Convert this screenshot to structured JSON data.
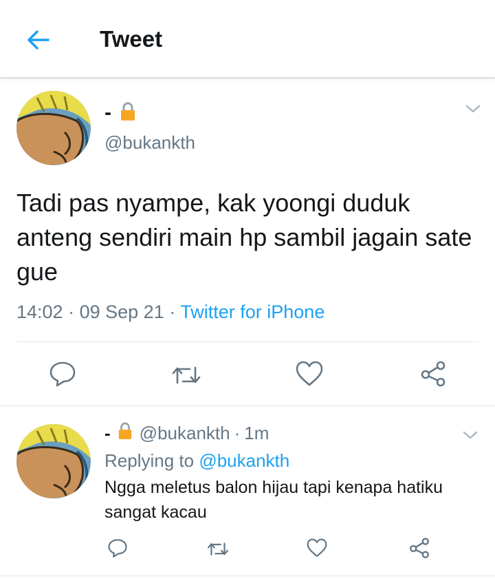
{
  "header": {
    "title": "Tweet"
  },
  "tweet": {
    "display_name": "-",
    "handle": "@bukankth",
    "text": "Tadi pas nyampe, kak yoongi duduk anteng sendiri main hp sambil jagain sate gue",
    "time": "14:02",
    "date": "09 Sep 21",
    "sep": "·",
    "source": "Twitter for iPhone"
  },
  "reply": {
    "display_name": "-",
    "handle": "@bukankth",
    "age": "1m",
    "sep": "·",
    "replying_label": "Replying to",
    "replying_to": "@bukankth",
    "text": "Ngga meletus balon hijau tapi kenapa hatiku sangat kacau"
  },
  "colors": {
    "accent": "#1da1f2",
    "muted": "#657786",
    "text": "#14171a",
    "lock": "#f5a623"
  },
  "icons": [
    "back-arrow-icon",
    "lock-icon",
    "chevron-down-icon",
    "reply-icon",
    "retweet-icon",
    "like-icon",
    "share-icon"
  ]
}
